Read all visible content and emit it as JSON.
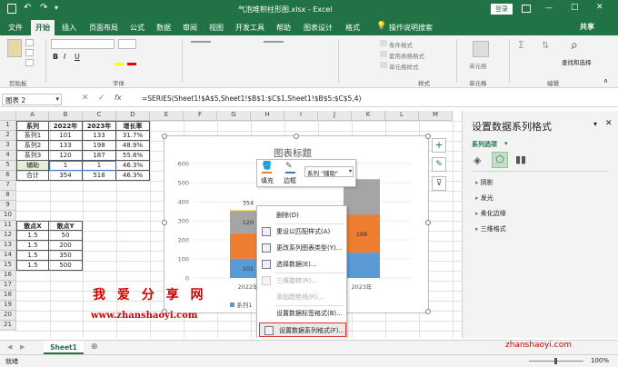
{
  "titlebar": {
    "title": "气泡堆积柱形图.xlsx  -  Excel",
    "login": "登录",
    "window_controls": [
      "—",
      "□",
      "✕"
    ]
  },
  "ribbon_tabs": [
    "文件",
    "开始",
    "插入",
    "页面布局",
    "公式",
    "数据",
    "审阅",
    "视图",
    "开发工具",
    "帮助",
    "图表设计",
    "格式"
  ],
  "ribbon_search": "操作说明搜索",
  "share": "共享",
  "ribbon_groups": {
    "clipboard": "剪贴板",
    "font": "字体",
    "styles": "样式",
    "cells": "单元格",
    "editing": "编辑"
  },
  "ribbon_labels": {
    "conditional": "条件格式",
    "table": "套用表格格式",
    "cellstyle": "单元格样式",
    "cells_btn": "单元格",
    "find": "查找和选择"
  },
  "formula_bar": {
    "namebox": "图表 2",
    "formula": "=SERIES(Sheet1!$A$5,Sheet1!$B$1:$C$1,Sheet1!$B$5:$C$5,4)"
  },
  "columns": [
    "A",
    "B",
    "C",
    "D",
    "E",
    "F",
    "G",
    "H",
    "I",
    "J",
    "K",
    "L",
    "M"
  ],
  "rows": [
    "1",
    "2",
    "3",
    "4",
    "5",
    "6",
    "7",
    "8",
    "9",
    "10",
    "11",
    "12",
    "13",
    "14",
    "15",
    "16",
    "17",
    "18",
    "19",
    "20",
    "21"
  ],
  "table": {
    "header": [
      "系列",
      "2022年",
      "2023年",
      "增长率"
    ],
    "rows": [
      [
        "系列1",
        "101",
        "133",
        "31.7%"
      ],
      [
        "系列2",
        "133",
        "198",
        "48.9%"
      ],
      [
        "系列3",
        "120",
        "187",
        "55.8%"
      ],
      [
        "辅助",
        "1",
        "1",
        "46.3%"
      ],
      [
        "合计",
        "354",
        "518",
        "46.3%"
      ]
    ]
  },
  "table2": {
    "header": [
      "散点X",
      "散点Y"
    ],
    "rows": [
      [
        "1.5",
        "50"
      ],
      [
        "1.5",
        "200"
      ],
      [
        "1.5",
        "350"
      ],
      [
        "1.5",
        "500"
      ]
    ]
  },
  "chart": {
    "title": "图表标题",
    "yticks": [
      "0",
      "100",
      "200",
      "300",
      "400",
      "500",
      "600"
    ],
    "categories": [
      "2022年",
      "2023年"
    ],
    "series1_labels": [
      "101",
      ""
    ],
    "series2_labels": [
      "",
      "198"
    ],
    "series3_labels": [
      "120",
      ""
    ],
    "total_labels": [
      "354",
      ""
    ],
    "legend_partial": "系列1"
  },
  "chart_data": {
    "type": "bar",
    "stacked": true,
    "title": "图表标题",
    "categories": [
      "2022年",
      "2023年"
    ],
    "series": [
      {
        "name": "系列1",
        "values": [
          101,
          133
        ],
        "color": "#5b9bd5"
      },
      {
        "name": "系列2",
        "values": [
          133,
          198
        ],
        "color": "#ed7d31"
      },
      {
        "name": "系列3",
        "values": [
          120,
          187
        ],
        "color": "#a5a5a5"
      },
      {
        "name": "辅助",
        "values": [
          1,
          1
        ],
        "color": "#ffc000"
      }
    ],
    "ylim": [
      0,
      600
    ],
    "grid": true
  },
  "mini_toolbar": {
    "fill": "填充",
    "outline": "边框",
    "series_select": "系列 \"辅助\""
  },
  "context_menu": [
    {
      "label": "删除(D)",
      "enabled": true,
      "icon": ""
    },
    {
      "label": "重设以匹配样式(A)",
      "enabled": true,
      "icon": "reset-icon"
    },
    {
      "label": "更改系列图表类型(Y)...",
      "enabled": true,
      "icon": "chart-type-icon"
    },
    {
      "label": "选择数据(E)...",
      "enabled": true,
      "icon": "select-data-icon"
    },
    {
      "label": "三维旋转(R)...",
      "enabled": false,
      "icon": "rotate-icon"
    },
    {
      "label": "添加趋势线(R)...",
      "enabled": false,
      "icon": ""
    },
    {
      "label": "设置数据标签格式(B)...",
      "enabled": true,
      "icon": ""
    },
    {
      "label": "设置数据系列格式(F)...",
      "enabled": true,
      "icon": "format-series-icon",
      "highlighted": true
    }
  ],
  "pane": {
    "title": "设置数据系列格式",
    "subtitle": "系列选项",
    "sections": [
      "阴影",
      "发光",
      "柔化边缘",
      "三维格式"
    ]
  },
  "watermark": {
    "brand": "我 爱 分 享 网",
    "url": "www.zhanshaoyi.com",
    "corner": "zhanshaoyi.com"
  },
  "sheet_tab": "Sheet1",
  "status": {
    "left": "就绪",
    "zoom": "100%"
  },
  "colors": {
    "excel_green": "#217346",
    "highlight_red": "#e03030",
    "watermark_red": "#d40000"
  }
}
